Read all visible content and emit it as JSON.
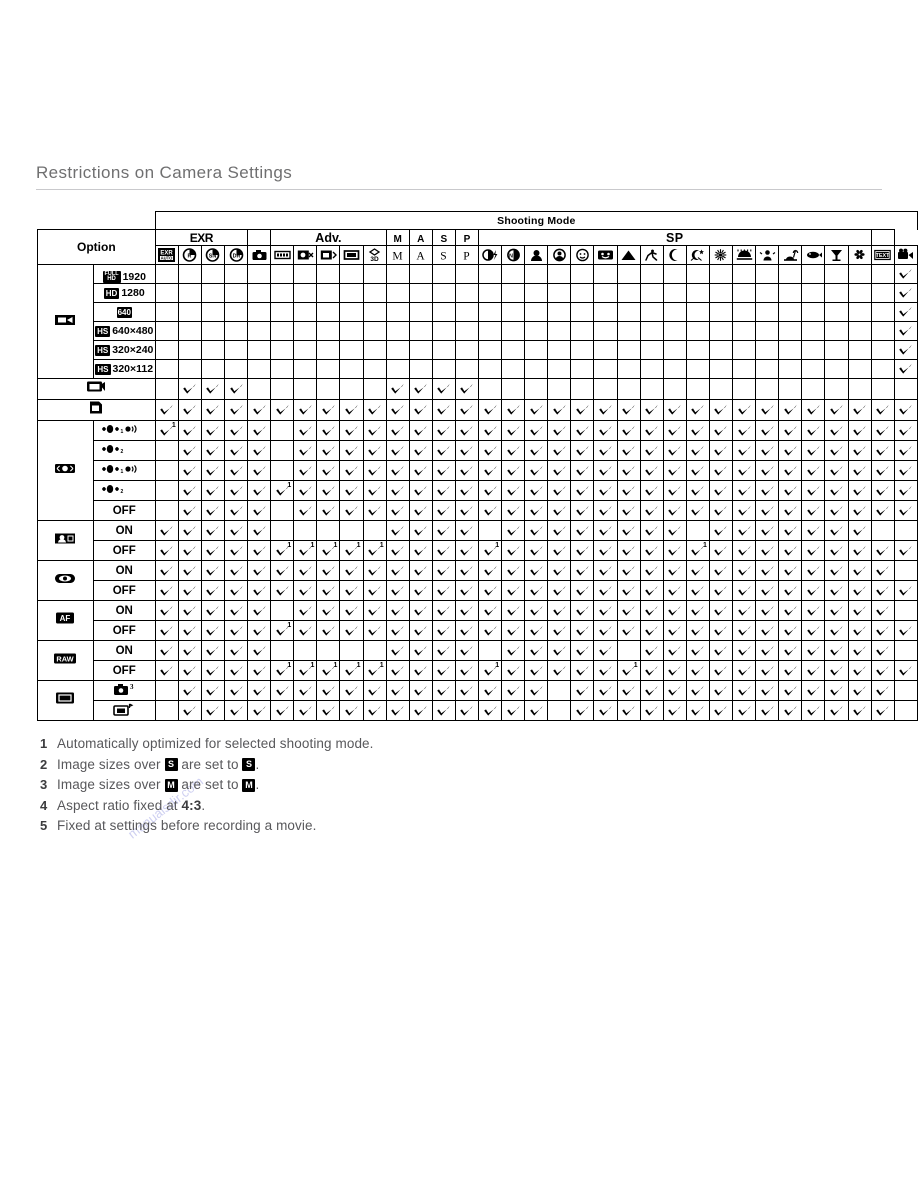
{
  "page": {
    "title": "Restrictions on Camera Settings"
  },
  "table": {
    "super_header": "Shooting Mode",
    "option_header": "Option",
    "groups": [
      {
        "label": "EXR",
        "span": 4
      },
      {
        "label": "",
        "span": 1
      },
      {
        "label": "Adv.",
        "span": 5
      },
      {
        "label": "M",
        "span": 1
      },
      {
        "label": "A",
        "span": 1
      },
      {
        "label": "S",
        "span": 1
      },
      {
        "label": "P",
        "span": 1
      },
      {
        "label": "SP",
        "span": 17
      },
      {
        "label": "",
        "span": 1
      }
    ],
    "columns": [
      {
        "icon": "exr-auto-icon",
        "label": "EXR AUTO"
      },
      {
        "icon": "exr-resolution-priority-icon",
        "label": "EXR Resolution Priority"
      },
      {
        "icon": "exr-high-iso-low-noise-icon",
        "label": "EXR High ISO & Low Noise"
      },
      {
        "icon": "exr-dynamic-range-priority-icon",
        "label": "EXR D-Range Priority"
      },
      {
        "icon": "auto-camera-icon",
        "label": "AUTO"
      },
      {
        "icon": "motion-panorama-icon",
        "label": "Motion Panorama"
      },
      {
        "icon": "pro-focus-icon",
        "label": "Pro Focus"
      },
      {
        "icon": "pro-low-light-icon",
        "label": "Pro Low-light"
      },
      {
        "icon": "multi-frame-icon",
        "label": "Multi Frame"
      },
      {
        "icon": "three-d-icon",
        "label": "3D"
      },
      {
        "icon": "mode-m-icon",
        "label": "M"
      },
      {
        "icon": "mode-a-icon",
        "label": "A"
      },
      {
        "icon": "mode-s-icon",
        "label": "S"
      },
      {
        "icon": "mode-p-icon",
        "label": "P"
      },
      {
        "icon": "natural-light-flash-icon",
        "label": "Natural Light & Flash"
      },
      {
        "icon": "natural-light-icon",
        "label": "Natural Light"
      },
      {
        "icon": "portrait-icon",
        "label": "Portrait"
      },
      {
        "icon": "portrait-enhancer-icon",
        "label": "Portrait Enhancer"
      },
      {
        "icon": "baby-icon",
        "label": "Baby"
      },
      {
        "icon": "smile-icon",
        "label": "Smile"
      },
      {
        "icon": "landscape-icon",
        "label": "Landscape"
      },
      {
        "icon": "sport-icon",
        "label": "Sport"
      },
      {
        "icon": "night-icon",
        "label": "Night"
      },
      {
        "icon": "night-tripod-icon",
        "label": "Night (Tripod)"
      },
      {
        "icon": "fireworks-icon",
        "label": "Fireworks"
      },
      {
        "icon": "sunset-icon",
        "label": "Sunset"
      },
      {
        "icon": "snow-icon",
        "label": "Snow"
      },
      {
        "icon": "beach-icon",
        "label": "Beach"
      },
      {
        "icon": "underwater-icon",
        "label": "Underwater"
      },
      {
        "icon": "party-icon",
        "label": "Party"
      },
      {
        "icon": "flower-icon",
        "label": "Flower"
      },
      {
        "icon": "text-icon",
        "label": "Text"
      },
      {
        "icon": "movie-icon",
        "label": "Movie"
      }
    ],
    "row_groups": [
      {
        "icon": "movie-mode-icon",
        "rows": [
          {
            "badge": "FULL HD",
            "label": "1920"
          },
          {
            "badge": "HD",
            "label": "1280"
          },
          {
            "badge": "640",
            "label": ""
          },
          {
            "badge": "HS",
            "label": "640×480"
          },
          {
            "badge": "HS",
            "label": "320×240"
          },
          {
            "badge": "HS",
            "label": "320×112"
          }
        ]
      },
      {
        "icon": "playback-movie-icon",
        "rows": [
          {
            "badge": "",
            "label": ""
          }
        ],
        "single": true
      },
      {
        "icon": "sd-card-icon",
        "rows": [
          {
            "badge": "",
            "label": ""
          }
        ],
        "single": true
      },
      {
        "icon": "image-stabilization-icon",
        "rows": [
          {
            "badge": "",
            "label": "IS-MODE-1-CONT"
          },
          {
            "badge": "",
            "label": "IS-MODE-2-SHOOT"
          },
          {
            "badge": "",
            "label": "IS-MODE-3-CONT"
          },
          {
            "badge": "",
            "label": "IS-MODE-4-SHOOT"
          },
          {
            "badge": "",
            "label": "OFF"
          }
        ]
      },
      {
        "icon": "face-detection-icon",
        "rows": [
          {
            "label": "ON"
          },
          {
            "label": "OFF"
          }
        ]
      },
      {
        "icon": "red-eye-removal-icon",
        "rows": [
          {
            "label": "ON"
          },
          {
            "label": "OFF"
          }
        ]
      },
      {
        "icon": "af-assist-icon",
        "rows": [
          {
            "label": "ON"
          },
          {
            "label": "OFF"
          }
        ]
      },
      {
        "icon": "raw-icon",
        "rows": [
          {
            "label": "ON"
          },
          {
            "label": "OFF"
          }
        ]
      },
      {
        "icon": "frame-guide-icon",
        "rows": [
          {
            "badge": "",
            "label": "SHOOT-FRAME-A"
          },
          {
            "badge": "",
            "label": "SHOOT-FRAME-B"
          }
        ]
      }
    ],
    "legend": {
      "available": "check",
      "unavailable": "hatched"
    },
    "cells": [
      [
        "h",
        "h",
        "h",
        "h",
        "h",
        "h",
        "h",
        "h",
        "h",
        "h",
        "h",
        "h",
        "h",
        "h",
        "h",
        "h",
        "h",
        "h",
        "h",
        "h",
        "h",
        "h",
        "h",
        "h",
        "h",
        "h",
        "h",
        "h",
        "h",
        "h",
        "h",
        "h",
        "c"
      ],
      [
        "h",
        "h",
        "h",
        "h",
        "h",
        "h",
        "h",
        "h",
        "h",
        "h",
        "h",
        "h",
        "h",
        "h",
        "h",
        "h",
        "h",
        "h",
        "h",
        "h",
        "h",
        "h",
        "h",
        "h",
        "h",
        "h",
        "h",
        "h",
        "h",
        "h",
        "h",
        "h",
        "c"
      ],
      [
        "h",
        "h",
        "h",
        "h",
        "h",
        "h",
        "h",
        "h",
        "h",
        "h",
        "h",
        "h",
        "h",
        "h",
        "h",
        "h",
        "h",
        "h",
        "h",
        "h",
        "h",
        "h",
        "h",
        "h",
        "h",
        "h",
        "h",
        "h",
        "h",
        "h",
        "h",
        "h",
        "c"
      ],
      [
        "h",
        "h",
        "h",
        "h",
        "h",
        "h",
        "h",
        "h",
        "h",
        "h",
        "h",
        "h",
        "h",
        "h",
        "h",
        "h",
        "h",
        "h",
        "h",
        "h",
        "h",
        "h",
        "h",
        "h",
        "h",
        "h",
        "h",
        "h",
        "h",
        "h",
        "h",
        "h",
        "c"
      ],
      [
        "h",
        "h",
        "h",
        "h",
        "h",
        "h",
        "h",
        "h",
        "h",
        "h",
        "h",
        "h",
        "h",
        "h",
        "h",
        "h",
        "h",
        "h",
        "h",
        "h",
        "h",
        "h",
        "h",
        "h",
        "h",
        "h",
        "h",
        "h",
        "h",
        "h",
        "h",
        "h",
        "c"
      ],
      [
        "h",
        "h",
        "h",
        "h",
        "h",
        "h",
        "h",
        "h",
        "h",
        "h",
        "h",
        "h",
        "h",
        "h",
        "h",
        "h",
        "h",
        "h",
        "h",
        "h",
        "h",
        "h",
        "h",
        "h",
        "h",
        "h",
        "h",
        "h",
        "h",
        "h",
        "h",
        "h",
        "c"
      ],
      [
        "h",
        "c",
        "c",
        "c",
        "h",
        "h",
        "h",
        "h",
        "h",
        "h",
        "c",
        "c",
        "c",
        "c",
        "h",
        "h",
        "h",
        "h",
        "h",
        "h",
        "h",
        "h",
        "h",
        "h",
        "h",
        "h",
        "h",
        "h",
        "h",
        "h",
        "h",
        "h",
        "h"
      ],
      [
        "c",
        "c",
        "c",
        "c",
        "c",
        "c",
        "c",
        "c",
        "c",
        "c",
        "c",
        "c",
        "c",
        "c",
        "c",
        "c",
        "c",
        "c",
        "c",
        "c",
        "c",
        "c",
        "c",
        "c",
        "c",
        "c",
        "c",
        "c",
        "c",
        "c",
        "c",
        "c",
        "c"
      ],
      [
        "c1",
        "c",
        "c",
        "c",
        "c",
        "h",
        "c",
        "c",
        "c",
        "c",
        "c",
        "c",
        "c",
        "c",
        "c",
        "c",
        "c",
        "c",
        "c",
        "c",
        "c",
        "c",
        "c",
        "c",
        "c",
        "c",
        "c",
        "c",
        "c",
        "c",
        "c",
        "c",
        "c"
      ],
      [
        "h",
        "c",
        "c",
        "c",
        "c",
        "h",
        "c",
        "c",
        "c",
        "c",
        "c",
        "c",
        "c",
        "c",
        "c",
        "c",
        "c",
        "c",
        "c",
        "c",
        "c",
        "c",
        "c",
        "c",
        "c",
        "c",
        "c",
        "c",
        "c",
        "c",
        "c",
        "c",
        "c"
      ],
      [
        "h",
        "c",
        "c",
        "c",
        "c",
        "h",
        "c",
        "c",
        "c",
        "c",
        "c",
        "c",
        "c",
        "c",
        "c",
        "c",
        "c",
        "c",
        "c",
        "c",
        "c",
        "c",
        "c",
        "c",
        "c",
        "c",
        "c",
        "c",
        "c",
        "c",
        "c",
        "c",
        "c"
      ],
      [
        "h",
        "c",
        "c",
        "c",
        "c",
        "c1",
        "c",
        "c",
        "c",
        "c",
        "c",
        "c",
        "c",
        "c",
        "c",
        "c",
        "c",
        "c",
        "c",
        "c",
        "c",
        "c",
        "c",
        "c",
        "c",
        "c",
        "c",
        "c",
        "c",
        "c",
        "c",
        "c",
        "c"
      ],
      [
        "h",
        "c",
        "c",
        "c",
        "c",
        "h",
        "c",
        "c",
        "c",
        "c",
        "c",
        "c",
        "c",
        "c",
        "c",
        "c",
        "c",
        "c",
        "c",
        "c",
        "c",
        "c",
        "c",
        "c",
        "c",
        "c",
        "c",
        "c",
        "c",
        "c",
        "c",
        "c",
        "c"
      ],
      [
        "c",
        "c",
        "c",
        "c",
        "c",
        "h",
        "h",
        "h",
        "h",
        "h",
        "c",
        "c",
        "c",
        "c",
        "h",
        "c",
        "c",
        "c",
        "c",
        "c",
        "c",
        "c",
        "c",
        "h",
        "c",
        "c",
        "c",
        "c",
        "c",
        "c",
        "c",
        "h",
        "h"
      ],
      [
        "c",
        "c",
        "c",
        "c",
        "c",
        "c1",
        "c1",
        "c1",
        "c1",
        "c1",
        "c",
        "c",
        "c",
        "c",
        "c1",
        "c",
        "c",
        "c",
        "c",
        "c",
        "c",
        "c",
        "c",
        "c1",
        "c",
        "c",
        "c",
        "c",
        "c",
        "c",
        "c",
        "c",
        "c"
      ],
      [
        "c",
        "c",
        "c",
        "c",
        "c",
        "c",
        "c",
        "c",
        "c",
        "c",
        "c",
        "c",
        "c",
        "c",
        "c",
        "c",
        "c",
        "c",
        "c",
        "c",
        "c",
        "c",
        "c",
        "c",
        "c",
        "c",
        "c",
        "c",
        "c",
        "c",
        "c",
        "c",
        "h"
      ],
      [
        "c",
        "c",
        "c",
        "c",
        "c",
        "c",
        "c",
        "c",
        "c",
        "c",
        "c",
        "c",
        "c",
        "c",
        "c",
        "c",
        "c",
        "c",
        "c",
        "c",
        "c",
        "c",
        "c",
        "c",
        "c",
        "c",
        "c",
        "c",
        "c",
        "c",
        "c",
        "c",
        "c"
      ],
      [
        "c",
        "c",
        "c",
        "c",
        "c",
        "h",
        "c",
        "c",
        "c",
        "c",
        "c",
        "c",
        "c",
        "c",
        "c",
        "c",
        "c",
        "c",
        "c",
        "c",
        "c",
        "c",
        "c",
        "c",
        "c",
        "c",
        "c",
        "c",
        "c",
        "c",
        "c",
        "c",
        "h"
      ],
      [
        "c",
        "c",
        "c",
        "c",
        "c",
        "c1",
        "c",
        "c",
        "c",
        "c",
        "c",
        "c",
        "c",
        "c",
        "c",
        "c",
        "c",
        "c",
        "c",
        "c",
        "c",
        "c",
        "c",
        "c",
        "c",
        "c",
        "c",
        "c",
        "c",
        "c",
        "c",
        "c",
        "c"
      ],
      [
        "c",
        "c",
        "c",
        "c",
        "c",
        "h",
        "h",
        "h",
        "h",
        "h",
        "c",
        "c",
        "c",
        "c",
        "h",
        "c",
        "c",
        "c",
        "c",
        "c",
        "h",
        "c",
        "c",
        "c",
        "c",
        "c",
        "c",
        "c",
        "c",
        "c",
        "c",
        "c",
        "h"
      ],
      [
        "c",
        "c",
        "c",
        "c",
        "c",
        "c1",
        "c1",
        "c1",
        "c1",
        "c1",
        "c",
        "c",
        "c",
        "c",
        "c1",
        "c",
        "c",
        "c",
        "c",
        "c",
        "c1",
        "c",
        "c",
        "c",
        "c",
        "c",
        "c",
        "c",
        "c",
        "c",
        "c",
        "c",
        "c"
      ],
      [
        "h",
        "c",
        "c",
        "c",
        "c",
        "c",
        "c",
        "c",
        "c",
        "c",
        "c",
        "c",
        "c",
        "c",
        "c",
        "c",
        "c",
        "h",
        "c",
        "c",
        "c",
        "c",
        "c",
        "c",
        "c",
        "c",
        "c",
        "c",
        "c",
        "c",
        "c",
        "c",
        "h"
      ],
      [
        "h",
        "c",
        "c",
        "c",
        "c",
        "c",
        "c",
        "c",
        "c",
        "c",
        "c",
        "c",
        "c",
        "c",
        "c",
        "c",
        "c",
        "h",
        "c",
        "c",
        "c",
        "c",
        "c",
        "c",
        "c",
        "c",
        "c",
        "c",
        "c",
        "c",
        "c",
        "c",
        "h"
      ]
    ]
  },
  "footnotes": [
    {
      "num": "1",
      "parts": [
        {
          "t": "Automatically optimized for selected shooting mode."
        }
      ]
    },
    {
      "num": "2",
      "parts": [
        {
          "t": "Image sizes over "
        },
        {
          "badge": "S"
        },
        {
          "t": " are set to "
        },
        {
          "badge": "S"
        },
        {
          "t": "."
        }
      ]
    },
    {
      "num": "3",
      "parts": [
        {
          "t": "Image sizes over "
        },
        {
          "badge": "M"
        },
        {
          "t": " are set to "
        },
        {
          "badge": "M"
        },
        {
          "t": "."
        }
      ]
    },
    {
      "num": "4",
      "parts": [
        {
          "t": "Aspect ratio fixed at "
        },
        {
          "b": "4:3"
        },
        {
          "t": "."
        }
      ]
    },
    {
      "num": "5",
      "parts": [
        {
          "t": "Fixed at settings before recording a movie."
        }
      ]
    }
  ],
  "colors": {
    "title": "#6f6f70",
    "note_text": "#58585b",
    "rule": "#c9c9cc",
    "grid": "#000000",
    "watermark": "#c6c8ef"
  }
}
